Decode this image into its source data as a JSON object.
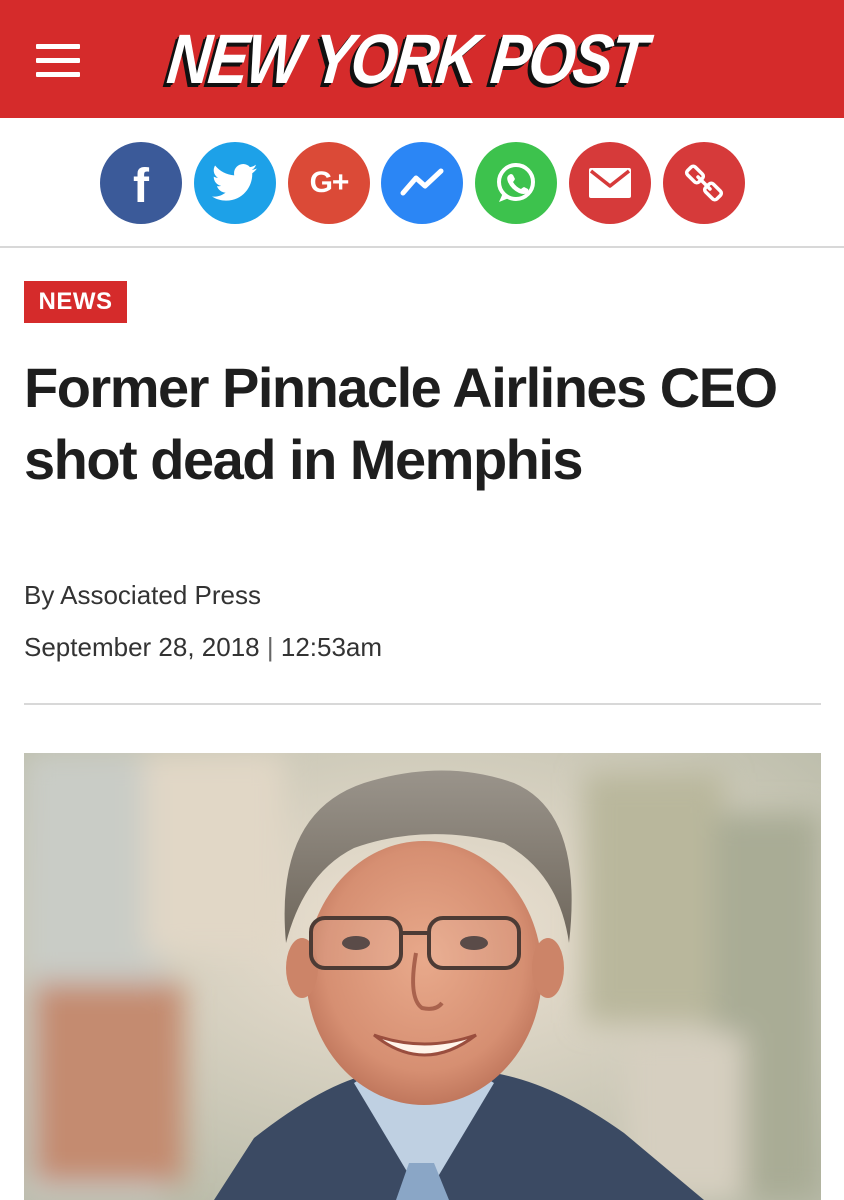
{
  "header": {
    "logo_text": "NEW YORK POST",
    "brand_color": "#d52b2b"
  },
  "share": {
    "buttons": [
      {
        "name": "facebook",
        "icon": "facebook-icon",
        "glyph": "f",
        "color": "#3b5a99"
      },
      {
        "name": "twitter",
        "icon": "twitter-icon",
        "color": "#1da1e8"
      },
      {
        "name": "google-plus",
        "icon": "google-plus-icon",
        "glyph": "G+",
        "color": "#db4a37"
      },
      {
        "name": "messenger",
        "icon": "messenger-icon",
        "color": "#2b86f5"
      },
      {
        "name": "whatsapp",
        "icon": "whatsapp-icon",
        "color": "#3dc24d"
      },
      {
        "name": "email",
        "icon": "email-icon",
        "color": "#d63a3a"
      },
      {
        "name": "copy-link",
        "icon": "link-icon",
        "color": "#d63a3a"
      }
    ]
  },
  "article": {
    "section": "NEWS",
    "headline": "Former Pinnacle Airlines CEO shot dead in Memphis",
    "byline": "By Associated Press",
    "date": "September 28, 2018",
    "time": "12:53am",
    "date_separator": "|"
  }
}
